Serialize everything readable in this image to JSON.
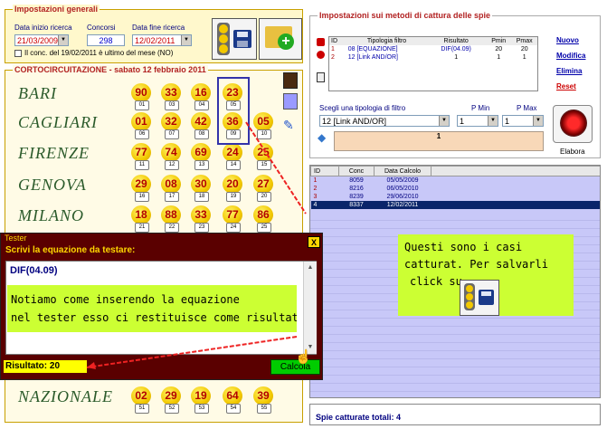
{
  "general": {
    "title": "Impostazioni generali",
    "start_label": "Data inizio ricerca",
    "start_value": "21/03/2009",
    "concorsi_label": "Concorsi",
    "concorsi_value": "298",
    "end_label": "Data fine ricerca",
    "end_value": "12/02/2011",
    "checkbox_label": "Il conc. del 19/02/2011 è ultimo del mese (NO)"
  },
  "circuit": {
    "title": "CORTOCIRCUITAZIONE - sabato 12 febbraio 2011",
    "wheels": [
      {
        "name": "BARI",
        "nums": [
          {
            "n": "90",
            "e": "01"
          },
          {
            "n": "33",
            "e": "03"
          },
          {
            "n": "16",
            "e": "04"
          },
          {
            "n": "23",
            "e": "05"
          }
        ]
      },
      {
        "name": "CAGLIARI",
        "nums": [
          {
            "n": "01",
            "e": "06"
          },
          {
            "n": "32",
            "e": "07"
          },
          {
            "n": "42",
            "e": "08"
          },
          {
            "n": "36",
            "e": "09"
          },
          {
            "n": "05",
            "e": "10"
          }
        ]
      },
      {
        "name": "FIRENZE",
        "nums": [
          {
            "n": "77",
            "e": "11"
          },
          {
            "n": "74",
            "e": "12"
          },
          {
            "n": "69",
            "e": "13"
          },
          {
            "n": "24",
            "e": "14"
          },
          {
            "n": "25",
            "e": "15"
          }
        ]
      },
      {
        "name": "GENOVA",
        "nums": [
          {
            "n": "29",
            "e": "16"
          },
          {
            "n": "08",
            "e": "17"
          },
          {
            "n": "30",
            "e": "18"
          },
          {
            "n": "20",
            "e": "19"
          },
          {
            "n": "27",
            "e": "20"
          }
        ]
      },
      {
        "name": "MILANO",
        "nums": [
          {
            "n": "18",
            "e": "21"
          },
          {
            "n": "88",
            "e": "22"
          },
          {
            "n": "33",
            "e": "23"
          },
          {
            "n": "77",
            "e": "24"
          },
          {
            "n": "86",
            "e": "25"
          }
        ]
      },
      {
        "name": "NAZIONALE",
        "nums": [
          {
            "n": "02",
            "e": "51"
          },
          {
            "n": "29",
            "e": "52"
          },
          {
            "n": "19",
            "e": "53"
          },
          {
            "n": "64",
            "e": "54"
          },
          {
            "n": "39",
            "e": "55"
          }
        ]
      }
    ]
  },
  "methods": {
    "title": "Impostazioni sui metodi di cattura delle spie",
    "headers": [
      "ID",
      "Tipologia filtro",
      "Risultato",
      "Pmin",
      "Pmax"
    ],
    "rows": [
      [
        "1",
        "08 [EQUAZIONE]",
        "DIF(04.09)",
        "20",
        "20"
      ],
      [
        "2",
        "12 [Link AND/OR]",
        "1",
        "1",
        "1"
      ]
    ],
    "links": [
      "Nuovo",
      "Modifica",
      "Elimina",
      "Reset"
    ],
    "choose_label": "Scegli una tipologia di filtro",
    "choose_value": "12 [Link AND/OR]",
    "pmin_label": "P Min",
    "pmin_value": "1",
    "pmax_label": "P Max",
    "pmax_value": "1",
    "param_value": "1",
    "elabora_label": "Elabora"
  },
  "results": {
    "headers": [
      "ID",
      "Conc",
      "Data Calcolo"
    ],
    "rows": [
      [
        "1",
        "8059",
        "05/05/2009"
      ],
      [
        "2",
        "8216",
        "06/05/2010"
      ],
      [
        "3",
        "8239",
        "29/06/2010"
      ],
      [
        "4",
        "8337",
        "12/02/2011"
      ]
    ],
    "footer": "Spie catturate totali: 4"
  },
  "tester": {
    "title": "Tester",
    "close": "X",
    "prompt": "Scrivi la equazione da testare:",
    "equation": "DIF(04.09)",
    "result_label": "Risultato: 20",
    "calc_button": "Calcola"
  },
  "notes": {
    "note1_line1": "Notiamo come inserendo la equazione",
    "note1_line2": "nel tester esso ci restituisce come risultato",
    "note2_line1": "Questi sono i casi",
    "note2_line2": "catturat. Per salvarli",
    "note2_line3": "click su"
  },
  "colors": {
    "red": "#b22222",
    "lime": "#ccff33",
    "dark_red": "#5a0000",
    "lavender": "#c8c8f8",
    "highlight": "#0a246a"
  }
}
